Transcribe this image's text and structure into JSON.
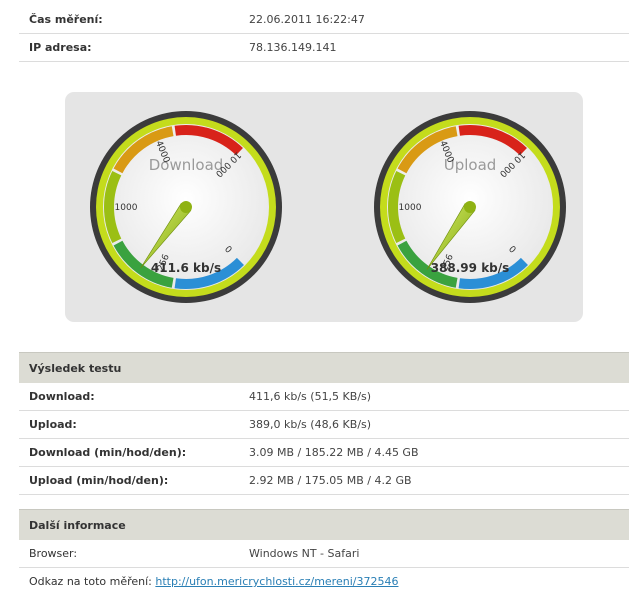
{
  "info": {
    "time_label": "Čas měření:",
    "time_value": "22.06.2011 16:22:47",
    "ip_label": "IP adresa:",
    "ip_value": "78.136.149.141"
  },
  "gauges": [
    {
      "title": "Download",
      "value_text": "411.6 kb/s",
      "value": 411.6,
      "ticks": [
        "0",
        "256",
        "1000",
        "4000",
        "10 000"
      ]
    },
    {
      "title": "Upload",
      "value_text": "388.99 kb/s",
      "value": 388.99,
      "ticks": [
        "0",
        "256",
        "1000",
        "4000",
        "10 000"
      ]
    }
  ],
  "results": {
    "heading": "Výsledek testu",
    "rows": [
      {
        "label": "Download:",
        "value": "411,6 kb/s (51,5 KB/s)"
      },
      {
        "label": "Upload:",
        "value": "389,0 kb/s (48,6 KB/s)"
      },
      {
        "label": "Download (min/hod/den):",
        "value": "3.09 MB / 185.22 MB / 4.45 GB"
      },
      {
        "label": "Upload (min/hod/den):",
        "value": "2.92 MB / 175.05 MB / 4.2 GB"
      }
    ]
  },
  "more": {
    "heading": "Další informace",
    "browser_label": "Browser:",
    "browser_value": "Windows NT - Safari",
    "link_label": "Odkaz na toto měření:",
    "link_text": "http://ufon.mericrychlosti.cz/mereni/372546"
  }
}
